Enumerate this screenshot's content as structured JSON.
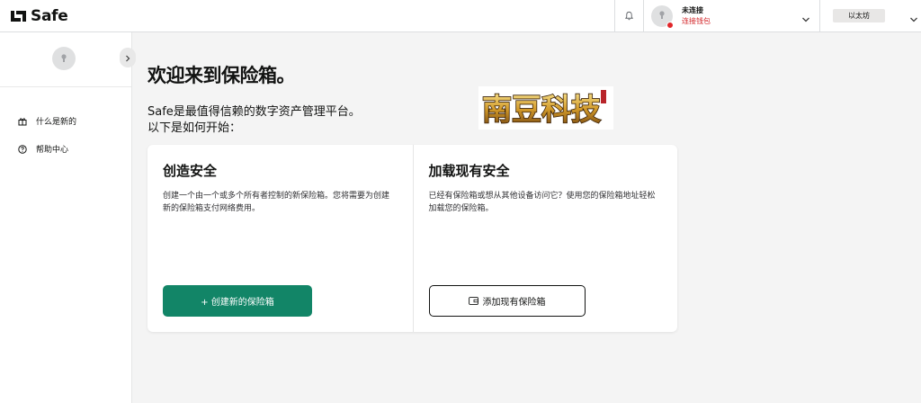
{
  "header": {
    "brand": "Safe",
    "wallet_status": "未连接",
    "wallet_connect": "连接钱包",
    "network": "以太坊"
  },
  "sidebar": {
    "items": [
      {
        "label": "什么是新的",
        "icon": "gift-icon"
      },
      {
        "label": "帮助中心",
        "icon": "help-circle-icon"
      }
    ]
  },
  "main": {
    "welcome": "欢迎来到保险箱。",
    "intro_line1": "Safe是最值得信赖的数字资产管理平台。",
    "intro_line2": "以下是如何开始：",
    "stamp_text": "南豆科技",
    "create": {
      "title": "创造安全",
      "description": "创建一个由一个或多个所有者控制的新保险箱。您将需要为创建新的保险箱支付网络费用。",
      "button": "+ 创建新的保险箱"
    },
    "load": {
      "title": "加载现有安全",
      "description": "已经有保险箱或想从其他设备访问它？使用您的保险箱地址轻松加载您的保险箱。",
      "button": "添加现有保险箱"
    }
  },
  "colors": {
    "accent": "#128567",
    "error": "#d3262a"
  }
}
